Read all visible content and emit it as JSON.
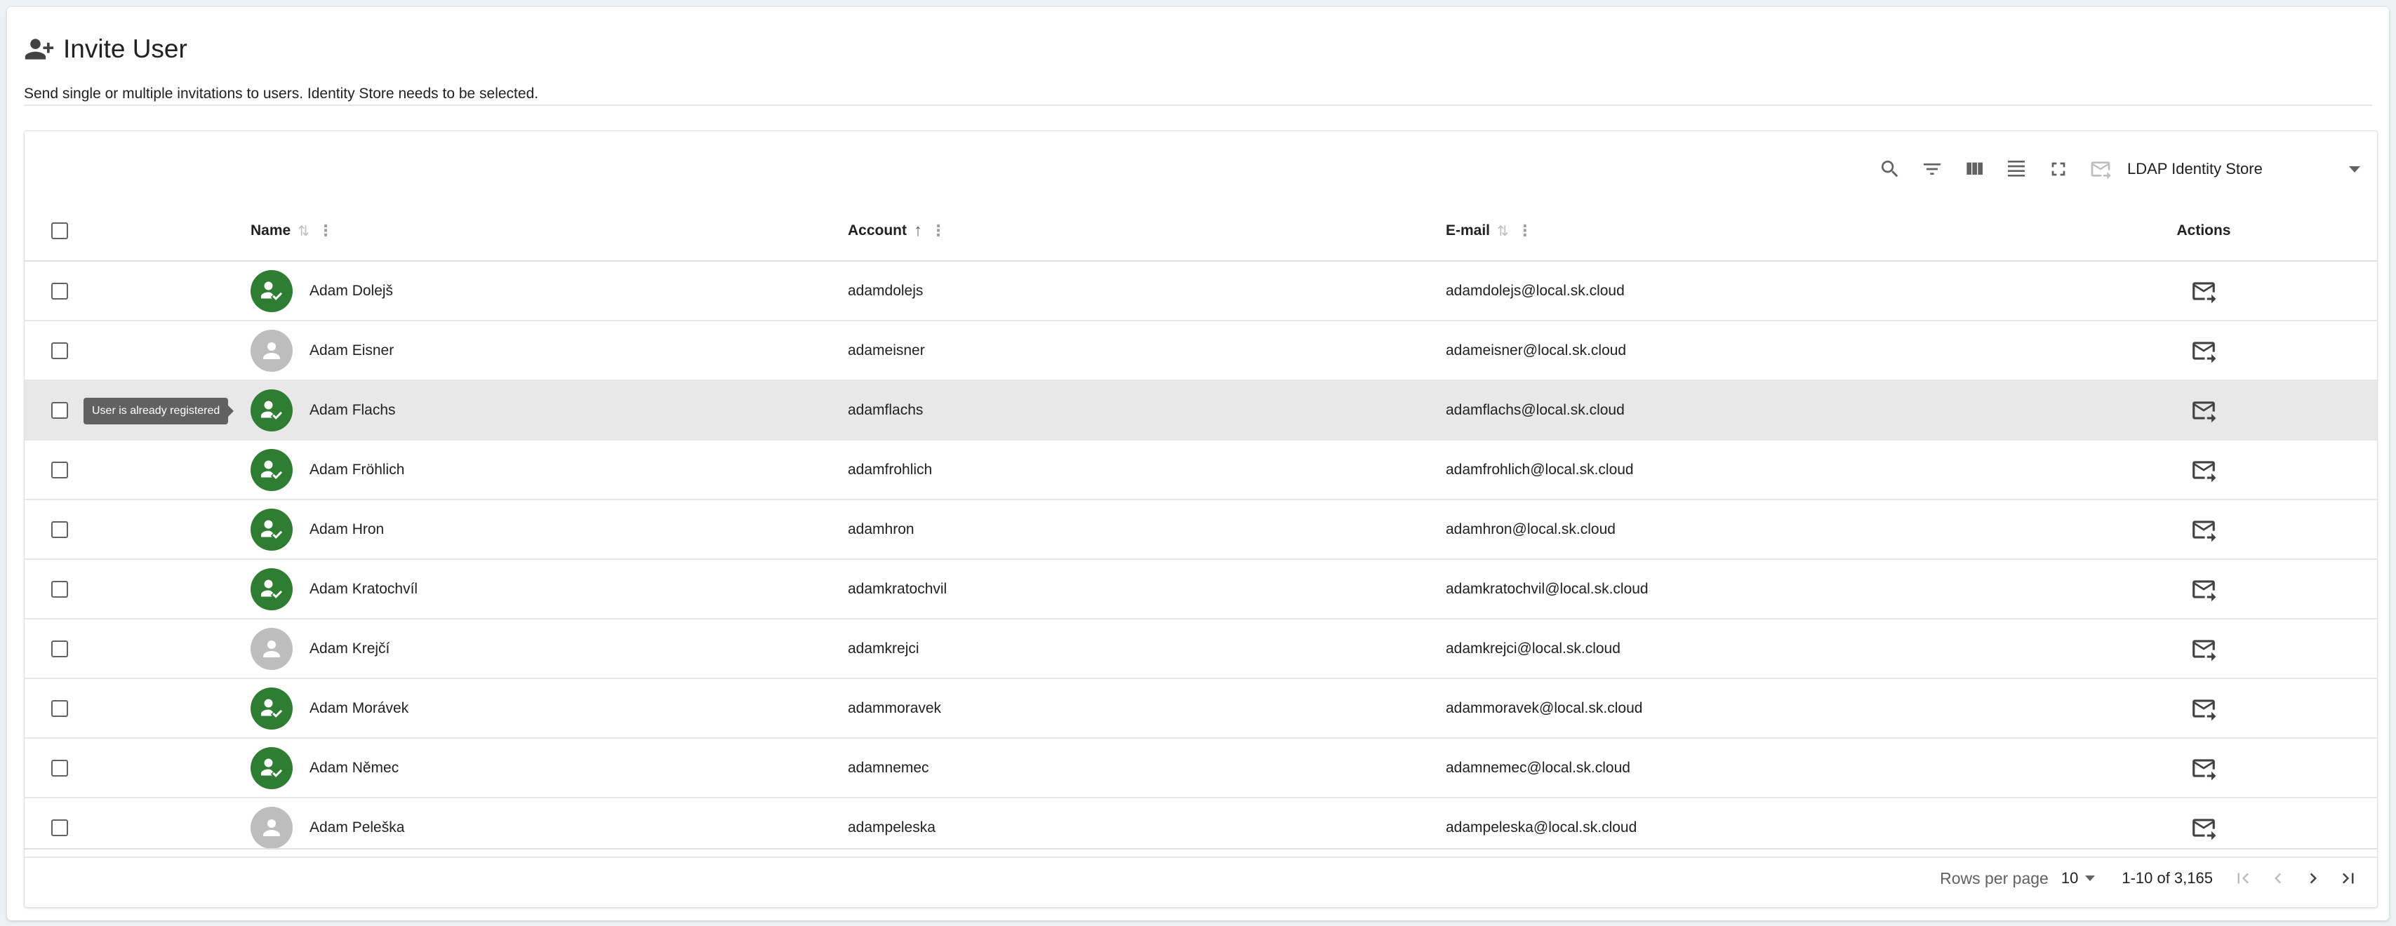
{
  "header": {
    "title": "Invite User",
    "subtitle": "Send single or multiple invitations to users. Identity Store needs to be selected."
  },
  "toolbar": {
    "icons": [
      "search-icon",
      "filter-icon",
      "view-columns-icon",
      "density-icon",
      "fullscreen-icon",
      "invite-mail-icon"
    ],
    "identity_store": "LDAP Identity Store"
  },
  "table": {
    "columns": {
      "name": "Name",
      "account": "Account",
      "email": "E-mail",
      "actions": "Actions"
    },
    "sorted_column": "Account",
    "sort_direction": "ascending",
    "tooltip": "User is already registered",
    "rows": [
      {
        "name": "Adam Dolejš",
        "account": "adamdolejs",
        "email": "adamdolejs@local.sk.cloud",
        "registered": true
      },
      {
        "name": "Adam Eisner",
        "account": "adameisner",
        "email": "adameisner@local.sk.cloud",
        "registered": false
      },
      {
        "name": "Adam Flachs",
        "account": "adamflachs",
        "email": "adamflachs@local.sk.cloud",
        "registered": true
      },
      {
        "name": "Adam Fröhlich",
        "account": "adamfrohlich",
        "email": "adamfrohlich@local.sk.cloud",
        "registered": true
      },
      {
        "name": "Adam Hron",
        "account": "adamhron",
        "email": "adamhron@local.sk.cloud",
        "registered": true
      },
      {
        "name": "Adam Kratochvíl",
        "account": "adamkratochvil",
        "email": "adamkratochvil@local.sk.cloud",
        "registered": true
      },
      {
        "name": "Adam Krejčí",
        "account": "adamkrejci",
        "email": "adamkrejci@local.sk.cloud",
        "registered": false
      },
      {
        "name": "Adam Morávek",
        "account": "adammoravek",
        "email": "adammoravek@local.sk.cloud",
        "registered": true
      },
      {
        "name": "Adam Němec",
        "account": "adamnemec",
        "email": "adamnemec@local.sk.cloud",
        "registered": true
      },
      {
        "name": "Adam Peleška",
        "account": "adampeleska",
        "email": "adampeleska@local.sk.cloud",
        "registered": false
      }
    ]
  },
  "footer": {
    "rows_per_page_label": "Rows per page",
    "rows_per_page": "10",
    "range": "1-10 of 3,165"
  },
  "colors": {
    "registered": "#2e7d32",
    "unregistered": "#bdbdbd",
    "highlight_row": "#e8e8e8"
  }
}
